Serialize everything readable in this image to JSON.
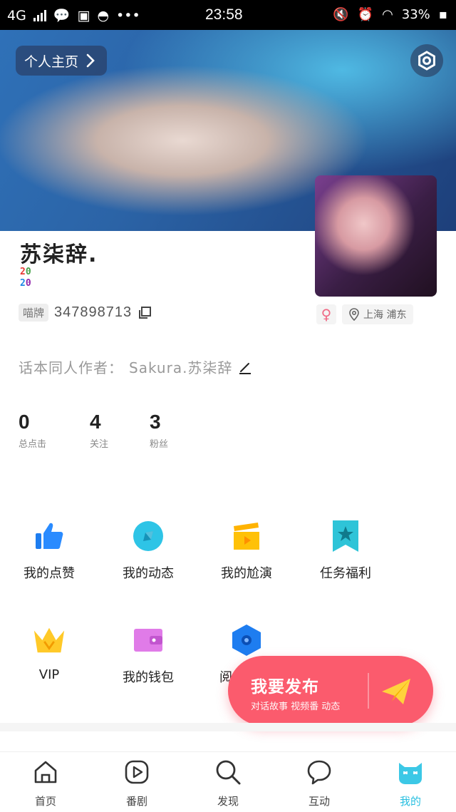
{
  "status_bar": {
    "network": "4G",
    "time": "23:58",
    "battery": "33%"
  },
  "cover": {
    "home_label": "个人主页"
  },
  "profile": {
    "name": "苏柒辞.",
    "badge_text": "20 20",
    "id_tag": "喵牌",
    "id_number": "347898713",
    "gender_symbol": "♀",
    "location": "上海 浦东",
    "author_label": "话本同人作者：",
    "author_value": "Sakura.苏柒辞"
  },
  "stats": [
    {
      "value": "0",
      "label": "总点击"
    },
    {
      "value": "4",
      "label": "关注"
    },
    {
      "value": "3",
      "label": "粉丝"
    }
  ],
  "menu": [
    {
      "label": "我的点赞",
      "icon": "thumbs-up-icon"
    },
    {
      "label": "我的动态",
      "icon": "compass-icon"
    },
    {
      "label": "我的尬演",
      "icon": "clapperboard-icon"
    },
    {
      "label": "任务福利",
      "icon": "bookmark-star-icon"
    },
    {
      "label": "VIP",
      "icon": "crown-icon"
    },
    {
      "label": "我的钱包",
      "icon": "wallet-icon"
    },
    {
      "label": "阅",
      "icon": "hexagon-icon"
    }
  ],
  "fab": {
    "title": "我要发布",
    "subtitle": "对话故事 视频番 动态"
  },
  "tabs": [
    {
      "label": "首页",
      "icon": "home-icon"
    },
    {
      "label": "番剧",
      "icon": "play-icon"
    },
    {
      "label": "发现",
      "icon": "search-icon"
    },
    {
      "label": "互动",
      "icon": "chat-bubble-icon"
    },
    {
      "label": "我的",
      "icon": "cat-face-icon"
    }
  ],
  "colors": {
    "accent": "#28bfe0",
    "fab": "#fb5b6d",
    "gender": "#f06a86"
  }
}
